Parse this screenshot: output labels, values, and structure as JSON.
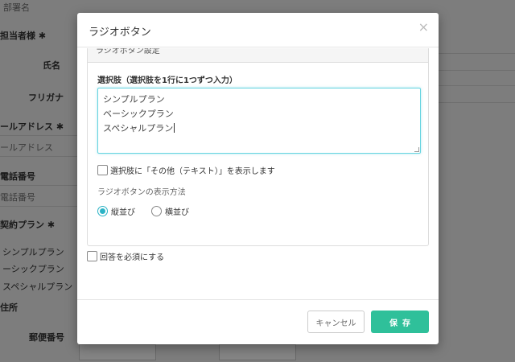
{
  "background": {
    "dept_label": "部署名",
    "person_label": "担当者様 ✱",
    "name_label": "氏名",
    "furigana_label": "フリガナ",
    "email_label": "ールアドレス ✱",
    "email_placeholder": "ールアドレス",
    "phone_label": "電話番号",
    "phone_placeholder": "電話番号",
    "plan_label": "契約プラン ✱",
    "plans": [
      "シンプルプラン",
      "ーシックプラン",
      "スペシャルプラン"
    ],
    "address_label": "住所",
    "postal_label": "郵便番号"
  },
  "modal": {
    "title": "ラジオボタン",
    "close": "×",
    "panel_heading": "ラジオボタン設定",
    "choices_label": "選択肢（選択肢を1行に1つずつ入力）",
    "choices": [
      "シンプルプラン",
      "ベーシックプラン",
      "スペシャルプラン"
    ],
    "other_option_label": "選択肢に「その他（テキスト）」を表示します",
    "display_method_label": "ラジオボタンの表示方法",
    "layout_options": [
      {
        "label": "縦並び",
        "selected": true
      },
      {
        "label": "横並び",
        "selected": false
      }
    ],
    "required_label": "回答を必須にする",
    "cancel_label": "キャンセル",
    "save_label": "保存"
  },
  "colors": {
    "accent": "#2bb3c5",
    "save": "#2fc09a"
  }
}
